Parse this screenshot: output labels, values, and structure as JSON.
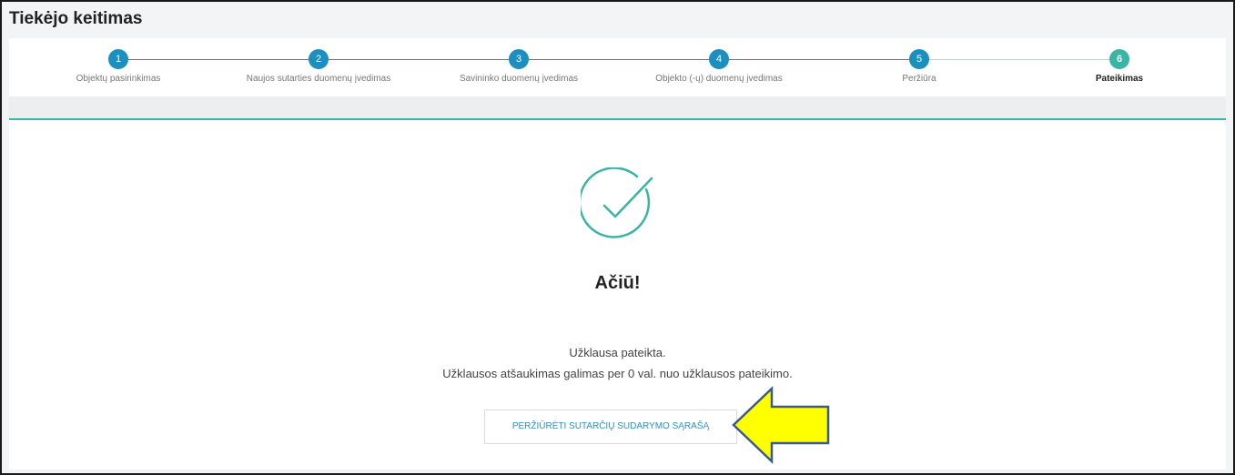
{
  "page": {
    "title": "Tiekėjo keitimas"
  },
  "colors": {
    "step_done": "#1a8fc0",
    "step_active": "#39b5a4",
    "line_done": "#1a8fc0",
    "line_pending": "#b7dd9a",
    "accent": "#39b5a4",
    "arrow_fill": "#ffff00",
    "arrow_stroke": "#3a5a8c"
  },
  "stepper": {
    "steps": [
      {
        "number": "1",
        "label": "Objektų pasirinkimas",
        "state": "done"
      },
      {
        "number": "2",
        "label": "Naujos sutarties duomenų įvedimas",
        "state": "done"
      },
      {
        "number": "3",
        "label": "Savininko duomenų įvedimas",
        "state": "done"
      },
      {
        "number": "4",
        "label": "Objekto (-ų) duomenų įvedimas",
        "state": "done"
      },
      {
        "number": "5",
        "label": "Peržiūra",
        "state": "done"
      },
      {
        "number": "6",
        "label": "Pateikimas",
        "state": "active"
      }
    ]
  },
  "result": {
    "icon": "checkmark-circle-icon",
    "heading": "Ačiū!",
    "line1": "Užklausa pateikta.",
    "line2": "Užklausos atšaukimas galimas per 0 val. nuo užklausos pateikimo.",
    "button_label": "PERŽIŪRĖTI SUTARČIŲ SUDARYMO SĄRAŠĄ"
  },
  "annotation": {
    "icon": "yellow-arrow-icon"
  }
}
